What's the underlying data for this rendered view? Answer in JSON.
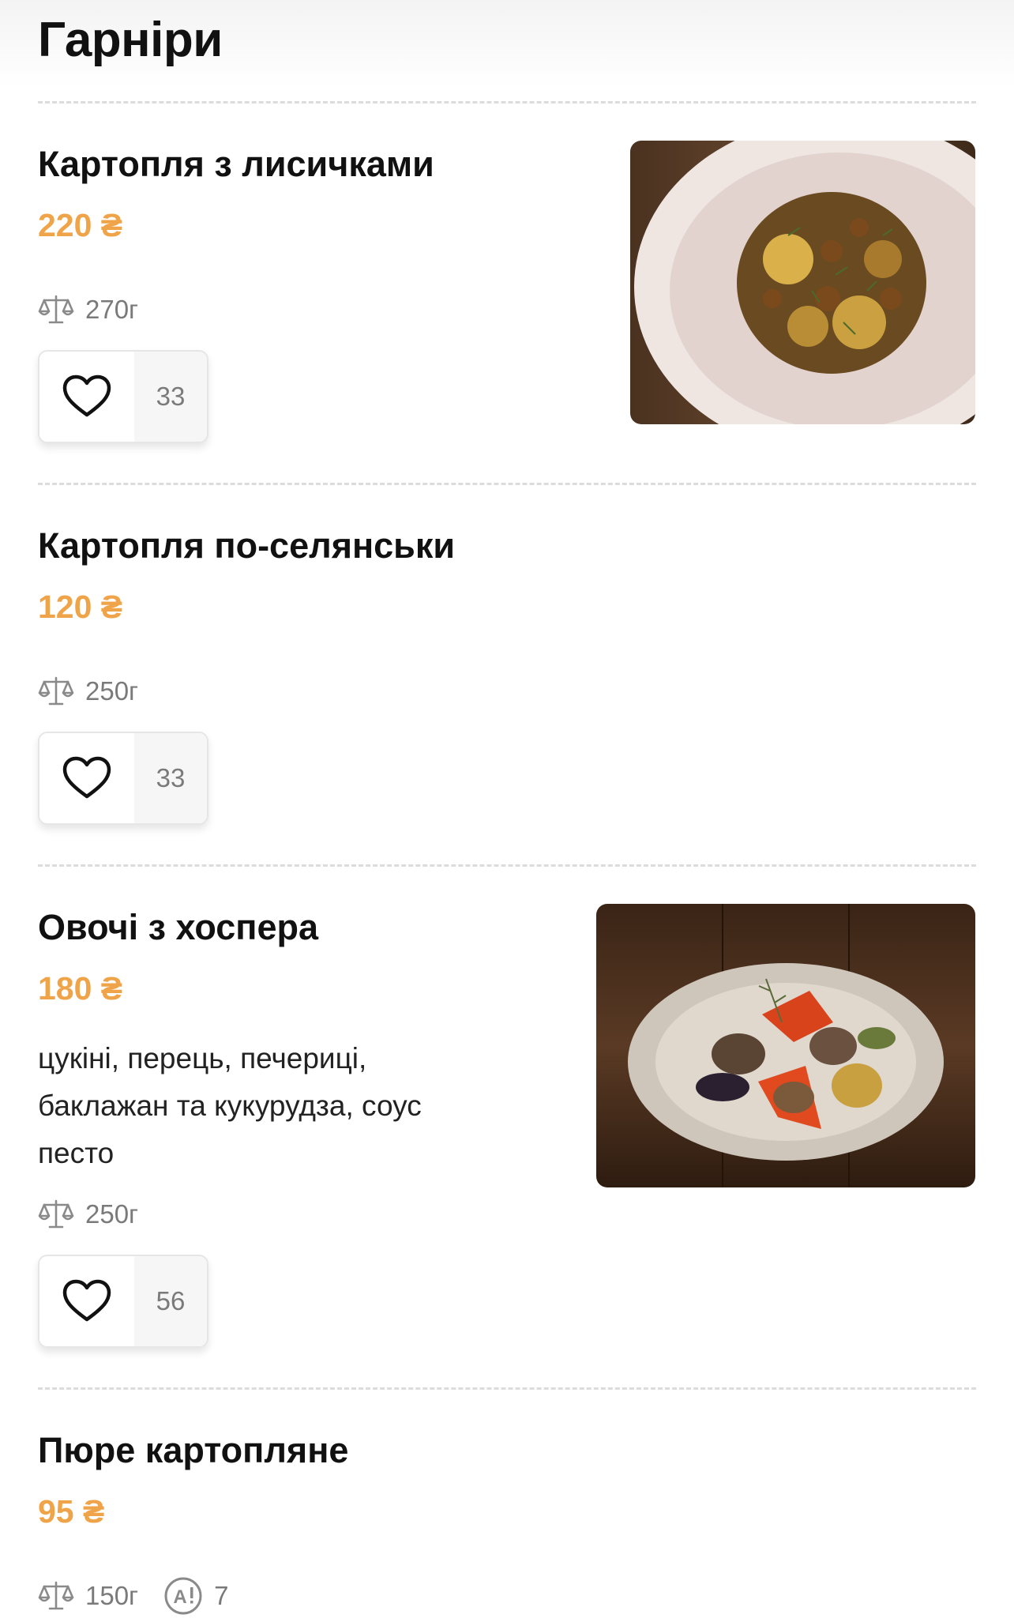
{
  "section": {
    "title": "Гарніри"
  },
  "items": [
    {
      "name": "Картопля з лисичками",
      "price": "220 ₴",
      "weight": "270г",
      "likes": "33",
      "has_photo": true
    },
    {
      "name": "Картопля по-селянськи",
      "price": "120 ₴",
      "weight": "250г",
      "likes": "33",
      "has_photo": false
    },
    {
      "name": "Овочі з хоспера",
      "price": "180 ₴",
      "description_lines": [
        "цукіні, перець, печериці,",
        "баклажан та кукурудза, соус",
        "песто"
      ],
      "weight": "250г",
      "likes": "56",
      "has_photo": true
    },
    {
      "name": "Пюре картопляне",
      "price": "95 ₴",
      "weight": "150г",
      "allergen_count": "7",
      "has_photo": false
    }
  ],
  "icons": {
    "weight": "scale-icon",
    "like": "heart-icon",
    "allergen": "allergen-icon"
  },
  "colors": {
    "price": "#f0a449",
    "text": "#111111",
    "muted": "#7a7a7a",
    "divider": "#dcdcdc"
  }
}
